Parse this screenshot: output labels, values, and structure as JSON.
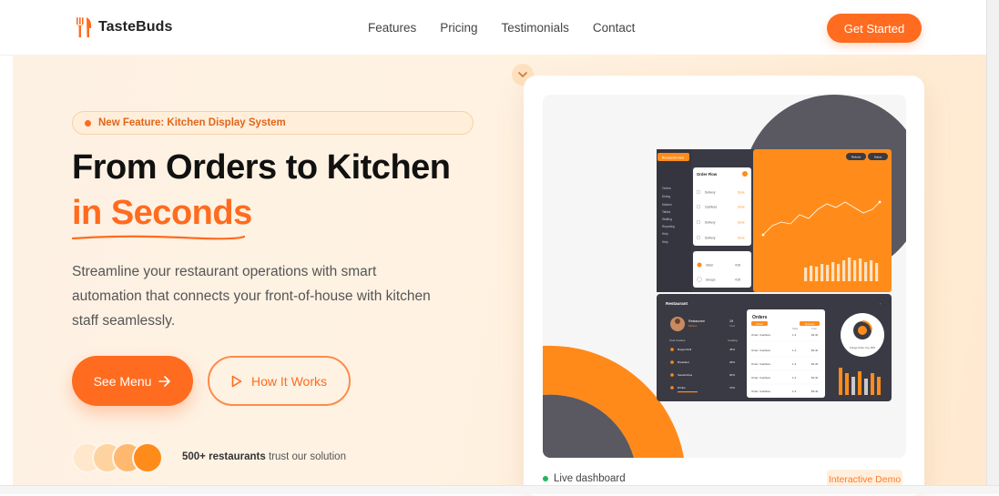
{
  "nav": {
    "brand": "TasteBuds",
    "links": [
      "Features",
      "Pricing",
      "Testimonials",
      "Contact"
    ],
    "cta": "Get Started"
  },
  "hero": {
    "badge": "New Feature: Kitchen Display System",
    "title_line1": "From Orders to Kitchen",
    "title_line2": "in Seconds",
    "description": "Streamline your restaurant operations with smart automation that connects your front-of-house with kitchen staff seamlessly.",
    "primary_button": "See Menu",
    "secondary_button": "How It Works",
    "trust_bold": "500+ restaurants",
    "trust_rest": " trust our solution"
  },
  "preview": {
    "live_label": "Live dashboard",
    "demo_tag": "Interactive Demo",
    "dash": {
      "top_tab": "Restaurant view",
      "card_title": "Order Flow",
      "card_rows": [
        "Delivery",
        "Cashless",
        "Delivery",
        "Delivery"
      ],
      "card_row_tag": "Done",
      "bottom_rows": [
        [
          "Order",
          "4:00"
        ],
        [
          "Groups",
          "4:00"
        ]
      ],
      "chip_labels": [
        "Refresh",
        "Status"
      ],
      "side_items": [
        "Orders",
        "Dining",
        "Kitchen",
        "Tables",
        "Staffing",
        "Reporting",
        "Help",
        "Help"
      ],
      "restaurant_title": "Restaurant",
      "profile_name": "Restaurant",
      "profile_sub": "Kitchen",
      "profile_count": "19",
      "profile_count_label": "Chef",
      "list_header_left": "Chef Cookies",
      "list_header_right": "Cooking",
      "list_items": [
        [
          "Burger/Grill",
          "45%"
        ],
        [
          "Breakfast",
          "28%"
        ],
        [
          "Sandwiches",
          "90%"
        ],
        [
          "Drinks",
          "70%"
        ]
      ],
      "orders_title": "Orders",
      "orders_tags": [
        "Active",
        "Queued"
      ],
      "orders_cols": [
        "Table",
        "Total"
      ],
      "orders_rows": [
        [
          "Order: Cashless",
          "1-3",
          "$3.40"
        ],
        [
          "Order: Cashless",
          "1-3",
          "$3.40"
        ],
        [
          "Order: Cashless",
          "1-3",
          "$3.40"
        ],
        [
          "Order: Cashless",
          "1-3",
          "$3.40"
        ],
        [
          "Order: Cashless",
          "1-3",
          "$3.40"
        ]
      ],
      "gauge_caption": "Orange Order: Avg. 68%"
    }
  },
  "colors": {
    "accent": "#ff6b1f",
    "dark": "#3b3b45",
    "hero_bg": "#fff2e2"
  }
}
